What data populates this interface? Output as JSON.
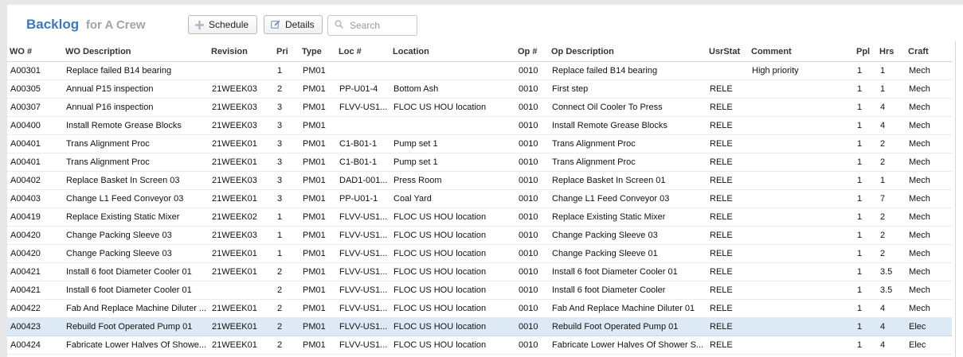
{
  "header": {
    "title": "Backlog",
    "subtitle": "for A Crew"
  },
  "toolbar": {
    "schedule_label": "Schedule",
    "schedule_icon": "plus-icon",
    "details_label": "Details",
    "details_icon": "edit-icon"
  },
  "search": {
    "placeholder": "Search",
    "value": "",
    "icon": "search-icon"
  },
  "colors": {
    "title": "#3d78b8",
    "subtitle": "#a3a3a3",
    "selected_row": "#dde9f4"
  },
  "table": {
    "columns": [
      {
        "key": "wo",
        "label": "WO #"
      },
      {
        "key": "wo_desc",
        "label": "WO Description"
      },
      {
        "key": "revision",
        "label": "Revision"
      },
      {
        "key": "pri",
        "label": "Pri"
      },
      {
        "key": "type",
        "label": "Type"
      },
      {
        "key": "loc",
        "label": "Loc #"
      },
      {
        "key": "location",
        "label": "Location"
      },
      {
        "key": "op",
        "label": "Op #"
      },
      {
        "key": "op_desc",
        "label": "Op Description"
      },
      {
        "key": "usrstat",
        "label": "UsrStat"
      },
      {
        "key": "comment",
        "label": "Comment"
      },
      {
        "key": "ppl",
        "label": "Ppl"
      },
      {
        "key": "hrs",
        "label": "Hrs"
      },
      {
        "key": "craft",
        "label": "Craft"
      }
    ],
    "rows": [
      {
        "wo": "A00301",
        "wo_desc": "Replace failed B14 bearing",
        "revision": "",
        "pri": "1",
        "type": "PM01",
        "loc": "",
        "location": "",
        "op": "0010",
        "op_desc": "Replace failed B14 bearing",
        "usrstat": "",
        "comment": "High priority",
        "ppl": "1",
        "hrs": "1",
        "craft": "Mech",
        "selected": false
      },
      {
        "wo": "A00305",
        "wo_desc": "Annual P15 inspection",
        "revision": "21WEEK03",
        "pri": "2",
        "type": "PM01",
        "loc": "PP-U01-4",
        "location": "Bottom Ash",
        "op": "0010",
        "op_desc": "First step",
        "usrstat": "RELE",
        "comment": "",
        "ppl": "1",
        "hrs": "1",
        "craft": "Mech",
        "selected": false
      },
      {
        "wo": "A00307",
        "wo_desc": "Annual P16 inspection",
        "revision": "21WEEK03",
        "pri": "3",
        "type": "PM01",
        "loc": "FLVV-US1...",
        "location": "FLOC US HOU location",
        "op": "0010",
        "op_desc": "Connect Oil Cooler To Press",
        "usrstat": "RELE",
        "comment": "",
        "ppl": "1",
        "hrs": "4",
        "craft": "Mech",
        "selected": false
      },
      {
        "wo": "A00400",
        "wo_desc": "Install Remote Grease Blocks",
        "revision": "21WEEK03",
        "pri": "3",
        "type": "PM01",
        "loc": "",
        "location": "",
        "op": "0010",
        "op_desc": "Install Remote Grease Blocks",
        "usrstat": "RELE",
        "comment": "",
        "ppl": "1",
        "hrs": "4",
        "craft": "Mech",
        "selected": false
      },
      {
        "wo": "A00401",
        "wo_desc": "Trans Alignment Proc",
        "revision": "21WEEK01",
        "pri": "3",
        "type": "PM01",
        "loc": "C1-B01-1",
        "location": "Pump set 1",
        "op": "0010",
        "op_desc": "Trans Alignment Proc",
        "usrstat": "RELE",
        "comment": "",
        "ppl": "1",
        "hrs": "2",
        "craft": "Mech",
        "selected": false
      },
      {
        "wo": "A00401",
        "wo_desc": "Trans Alignment Proc",
        "revision": "21WEEK01",
        "pri": "3",
        "type": "PM01",
        "loc": "C1-B01-1",
        "location": "Pump set 1",
        "op": "0010",
        "op_desc": "Trans Alignment Proc",
        "usrstat": "RELE",
        "comment": "",
        "ppl": "1",
        "hrs": "2",
        "craft": "Mech",
        "selected": false
      },
      {
        "wo": "A00402",
        "wo_desc": "Replace Basket In Screen 03",
        "revision": "21WEEK03",
        "pri": "3",
        "type": "PM01",
        "loc": "DAD1-001...",
        "location": "Press Room",
        "op": "0010",
        "op_desc": "Replace Basket In Screen 01",
        "usrstat": "RELE",
        "comment": "",
        "ppl": "1",
        "hrs": "1",
        "craft": "Mech",
        "selected": false
      },
      {
        "wo": "A00403",
        "wo_desc": "Change L1 Feed Conveyor 03",
        "revision": "21WEEK01",
        "pri": "3",
        "type": "PM01",
        "loc": "PP-U01-1",
        "location": "Coal Yard",
        "op": "0010",
        "op_desc": "Change L1 Feed Conveyor 03",
        "usrstat": "RELE",
        "comment": "",
        "ppl": "1",
        "hrs": "7",
        "craft": "Mech",
        "selected": false
      },
      {
        "wo": "A00419",
        "wo_desc": "Replace Existing Static Mixer",
        "revision": "21WEEK02",
        "pri": "1",
        "type": "PM01",
        "loc": "FLVV-US1...",
        "location": "FLOC US HOU location",
        "op": "0010",
        "op_desc": "Replace Existing Static Mixer",
        "usrstat": "RELE",
        "comment": "",
        "ppl": "1",
        "hrs": "2",
        "craft": "Mech",
        "selected": false
      },
      {
        "wo": "A00420",
        "wo_desc": "Change Packing Sleeve 03",
        "revision": "21WEEK03",
        "pri": "1",
        "type": "PM01",
        "loc": "FLVV-US1...",
        "location": "FLOC US HOU location",
        "op": "0010",
        "op_desc": "Change Packing Sleeve 03",
        "usrstat": "RELE",
        "comment": "",
        "ppl": "1",
        "hrs": "2",
        "craft": "Mech",
        "selected": false
      },
      {
        "wo": "A00420",
        "wo_desc": "Change Packing Sleeve 03",
        "revision": "21WEEK01",
        "pri": "1",
        "type": "PM01",
        "loc": "FLVV-US1...",
        "location": "FLOC US HOU location",
        "op": "0010",
        "op_desc": "Change Packing Sleeve 01",
        "usrstat": "RELE",
        "comment": "",
        "ppl": "1",
        "hrs": "2",
        "craft": "Mech",
        "selected": false
      },
      {
        "wo": "A00421",
        "wo_desc": "Install 6 foot Diameter Cooler 01",
        "revision": "21WEEK01",
        "pri": "2",
        "type": "PM01",
        "loc": "FLVV-US1...",
        "location": "FLOC US HOU location",
        "op": "0010",
        "op_desc": "Install 6 foot Diameter Cooler 01",
        "usrstat": "RELE",
        "comment": "",
        "ppl": "1",
        "hrs": "3.5",
        "craft": "Mech",
        "selected": false
      },
      {
        "wo": "A00421",
        "wo_desc": "Install 6 foot Diameter Cooler 01",
        "revision": "",
        "pri": "2",
        "type": "PM01",
        "loc": "FLVV-US1...",
        "location": "FLOC US HOU location",
        "op": "0010",
        "op_desc": "Install 6 foot Diameter Cooler",
        "usrstat": "RELE",
        "comment": "",
        "ppl": "1",
        "hrs": "3.5",
        "craft": "Mech",
        "selected": false
      },
      {
        "wo": "A00422",
        "wo_desc": "Fab And Replace Machine Diluter ...",
        "revision": "21WEEK01",
        "pri": "2",
        "type": "PM01",
        "loc": "FLVV-US1...",
        "location": "FLOC US HOU location",
        "op": "0010",
        "op_desc": "Fab And Replace Machine Diluter 01",
        "usrstat": "RELE",
        "comment": "",
        "ppl": "1",
        "hrs": "4",
        "craft": "Mech",
        "selected": false
      },
      {
        "wo": "A00423",
        "wo_desc": "Rebuild Foot Operated Pump 01",
        "revision": "21WEEK01",
        "pri": "2",
        "type": "PM01",
        "loc": "FLVV-US1...",
        "location": "FLOC US HOU location",
        "op": "0010",
        "op_desc": "Rebuild Foot Operated Pump 01",
        "usrstat": "RELE",
        "comment": "",
        "ppl": "1",
        "hrs": "4",
        "craft": "Elec",
        "selected": true
      },
      {
        "wo": "A00424",
        "wo_desc": "Fabricate Lower Halves Of Showe...",
        "revision": "21WEEK01",
        "pri": "2",
        "type": "PM01",
        "loc": "FLVV-US1...",
        "location": "FLOC US HOU location",
        "op": "0010",
        "op_desc": "Fabricate Lower Halves Of Shower S...",
        "usrstat": "RELE",
        "comment": "",
        "ppl": "1",
        "hrs": "4",
        "craft": "Elec",
        "selected": false
      }
    ]
  }
}
